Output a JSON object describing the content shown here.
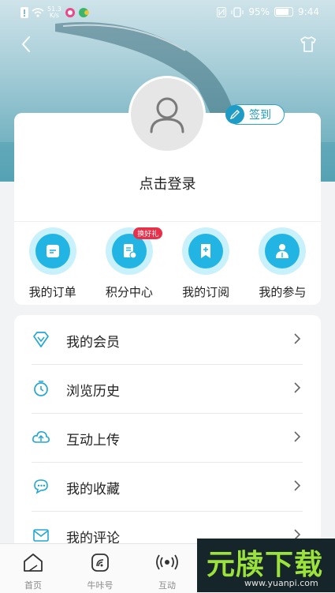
{
  "status_bar": {
    "speed_value": "51.3",
    "speed_unit": "K/s",
    "battery": "95%",
    "time": "9:44"
  },
  "profile": {
    "login_prompt": "点击登录",
    "signin_label": "签到"
  },
  "quick_actions": [
    {
      "label": "我的订单",
      "icon": "order-icon"
    },
    {
      "label": "积分中心",
      "icon": "points-icon",
      "badge": "换好礼"
    },
    {
      "label": "我的订阅",
      "icon": "bookmark-icon"
    },
    {
      "label": "我的参与",
      "icon": "participation-icon"
    }
  ],
  "menu": [
    {
      "label": "我的会员",
      "icon": "diamond-icon"
    },
    {
      "label": "浏览历史",
      "icon": "clock-icon"
    },
    {
      "label": "互动上传",
      "icon": "cloud-upload-icon"
    },
    {
      "label": "我的收藏",
      "icon": "chat-bubbles-icon"
    },
    {
      "label": "我的评论",
      "icon": "mail-icon"
    }
  ],
  "tabs": [
    {
      "label": "首页",
      "icon": "home-icon"
    },
    {
      "label": "牛咔号",
      "icon": "nk-icon"
    },
    {
      "label": "互动",
      "icon": "broadcast-icon"
    }
  ],
  "watermark": {
    "title": "元牍下载",
    "url": "www.yuanpi.com"
  },
  "colors": {
    "accent": "#22b5e3",
    "badge": "#e8304a",
    "watermark_green": "#9be23a"
  }
}
